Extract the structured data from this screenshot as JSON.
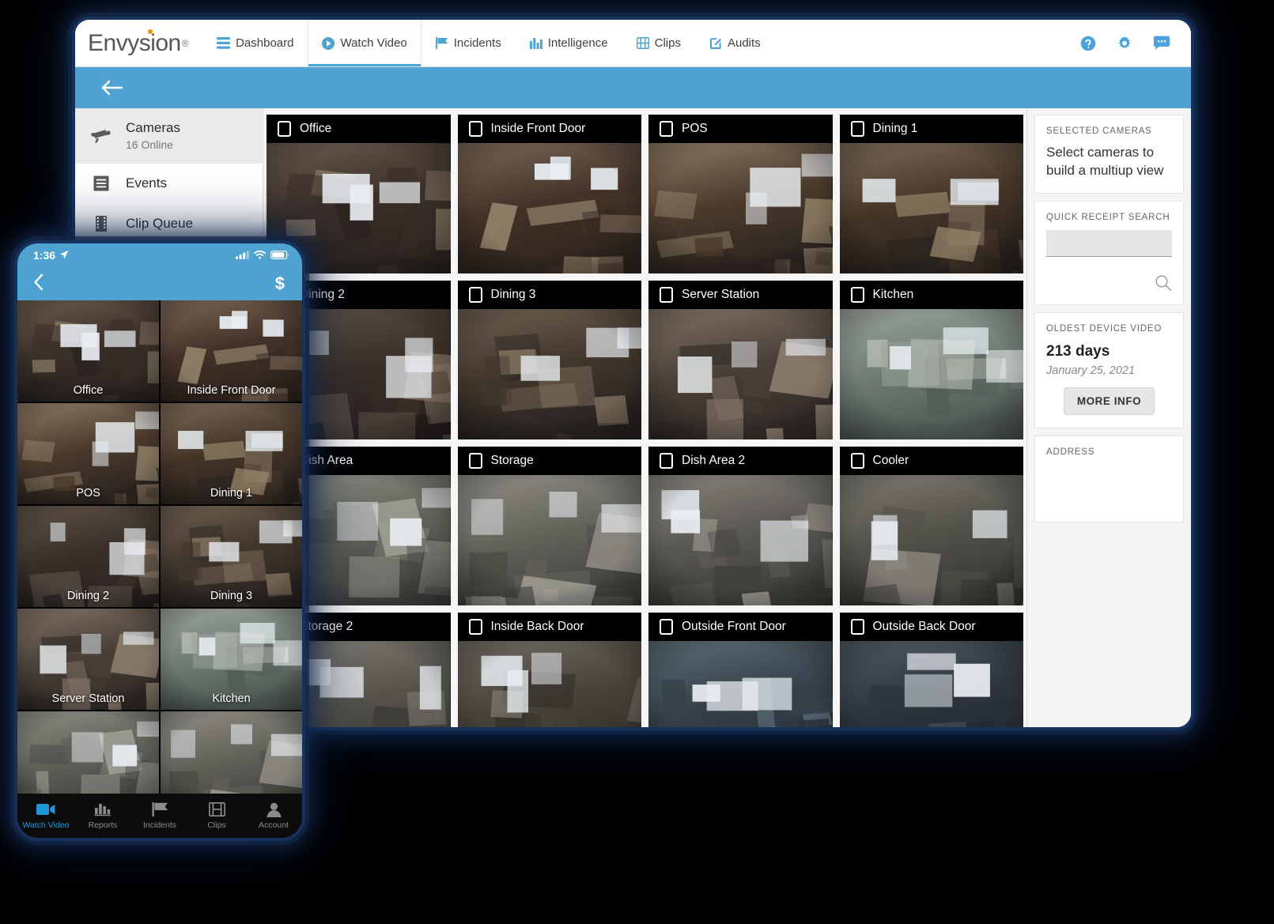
{
  "app": {
    "brand": "Envysion",
    "brand_registered": "®",
    "nav": [
      {
        "label": "Dashboard",
        "icon": "dashboard-icon",
        "active": false
      },
      {
        "label": "Watch Video",
        "icon": "play-circle-icon",
        "active": true
      },
      {
        "label": "Incidents",
        "icon": "flag-icon",
        "active": false
      },
      {
        "label": "Intelligence",
        "icon": "bar-chart-icon",
        "active": false
      },
      {
        "label": "Clips",
        "icon": "film-icon",
        "active": false
      },
      {
        "label": "Audits",
        "icon": "pencil-square-icon",
        "active": false
      }
    ],
    "nav_right": [
      {
        "icon": "help-icon"
      },
      {
        "icon": "gear-icon"
      },
      {
        "icon": "chat-icon"
      }
    ],
    "toolbar": {
      "back_icon": "back-arrow-icon"
    },
    "accent_blue": "#4FA3D1"
  },
  "sidebar": {
    "items": [
      {
        "label": "Cameras",
        "sub": "16 Online",
        "icon": "security-camera-icon",
        "active": true
      },
      {
        "label": "Events",
        "sub": "",
        "icon": "events-list-icon",
        "active": false
      },
      {
        "label": "Clip Queue",
        "sub": "",
        "icon": "film-strip-icon",
        "active": false
      }
    ]
  },
  "cameras": [
    {
      "name": "Office",
      "checked": false
    },
    {
      "name": "Inside Front Door",
      "checked": false
    },
    {
      "name": "POS",
      "checked": false
    },
    {
      "name": "Dining 1",
      "checked": false
    },
    {
      "name": "Dining 2",
      "checked": false
    },
    {
      "name": "Dining 3",
      "checked": false
    },
    {
      "name": "Server Station",
      "checked": false
    },
    {
      "name": "Kitchen",
      "checked": false
    },
    {
      "name": "Dish Area",
      "checked": false
    },
    {
      "name": "Storage",
      "checked": false
    },
    {
      "name": "Dish Area 2",
      "checked": false
    },
    {
      "name": "Cooler",
      "checked": false
    },
    {
      "name": "Storage 2",
      "checked": false
    },
    {
      "name": "Inside Back Door",
      "checked": false
    },
    {
      "name": "Outside Front Door",
      "checked": false
    },
    {
      "name": "Outside Back Door",
      "checked": false
    }
  ],
  "right_panel": {
    "selected_cameras": {
      "label": "SELECTED CAMERAS",
      "message": "Select cameras to build a multiup view"
    },
    "quick_receipt_search": {
      "label": "QUICK RECEIPT SEARCH",
      "value": "",
      "placeholder": "",
      "search_icon": "search-icon"
    },
    "oldest_device_video": {
      "label": "OLDEST DEVICE VIDEO",
      "days": "213 days",
      "date": "January 25, 2021",
      "button": "MORE INFO"
    },
    "address": {
      "label": "ADDRESS",
      "value": ""
    }
  },
  "phone": {
    "status": {
      "time": "1:36",
      "location_icon": "location-arrow-icon",
      "signal_icon": "cell-signal-icon",
      "wifi_icon": "wifi-icon",
      "battery_icon": "battery-icon"
    },
    "nav": {
      "back_icon": "chevron-left-icon",
      "action": "$"
    },
    "cameras": [
      "Office",
      "Inside Front Door",
      "POS",
      "Dining 1",
      "Dining 2",
      "Dining 3",
      "Server Station",
      "Kitchen",
      "",
      ""
    ],
    "tabs": [
      {
        "label": "Watch Video",
        "icon": "video-camera-icon",
        "active": true
      },
      {
        "label": "Reports",
        "icon": "bar-chart-icon",
        "active": false
      },
      {
        "label": "Incidents",
        "icon": "flag-icon",
        "active": false
      },
      {
        "label": "Clips",
        "icon": "film-icon",
        "active": false
      },
      {
        "label": "Account",
        "icon": "person-icon",
        "active": false
      }
    ]
  }
}
